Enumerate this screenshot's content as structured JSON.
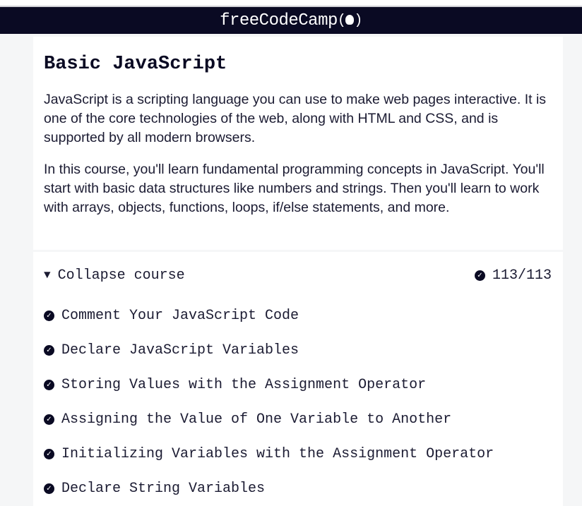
{
  "navbar": {
    "brand": "freeCodeCamp(🔥)",
    "brand_text": "freeCodeCamp",
    "flame": "(🔥)"
  },
  "intro": {
    "title": "Basic JavaScript",
    "paragraphs": [
      "JavaScript is a scripting language you can use to make web pages interactive. It is one of the core technologies of the web, along with HTML and CSS, and is supported by all modern browsers.",
      "In this course, you'll learn fundamental programming concepts in JavaScript. You'll start with basic data structures like numbers and strings. Then you'll learn to work with arrays, objects, functions, loops, if/else statements, and more."
    ]
  },
  "course": {
    "collapse_label": "Collapse course",
    "progress": "113/113",
    "lessons": [
      "Comment Your JavaScript Code",
      "Declare JavaScript Variables",
      "Storing Values with the Assignment Operator",
      "Assigning the Value of One Variable to Another",
      "Initializing Variables with the Assignment Operator",
      "Declare String Variables"
    ]
  }
}
